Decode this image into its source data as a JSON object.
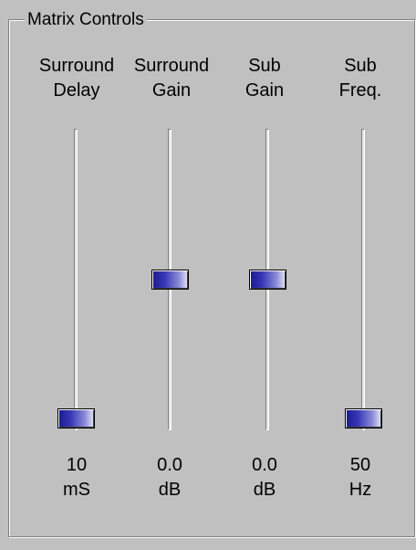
{
  "group": {
    "title": "Matrix Controls"
  },
  "sliders": [
    {
      "label_line1": "Surround",
      "label_line2": "Delay",
      "value": "10",
      "unit": "mS",
      "level": 0.0
    },
    {
      "label_line1": "Surround",
      "label_line2": "Gain",
      "value": "0.0",
      "unit": "dB",
      "level": 0.5
    },
    {
      "label_line1": "Sub",
      "label_line2": "Gain",
      "value": "0.0",
      "unit": "dB",
      "level": 0.5
    },
    {
      "label_line1": "Sub",
      "label_line2": "Freq.",
      "value": "50",
      "unit": "Hz",
      "level": 0.0
    }
  ],
  "colors": {
    "background": "#c0c0c0",
    "thumb_dark": "#1a1a90",
    "thumb_light": "#e6e6fa"
  }
}
